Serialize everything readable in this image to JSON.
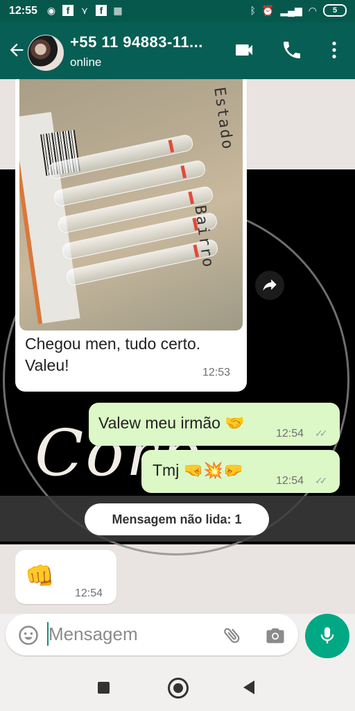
{
  "statusbar": {
    "time": "12:55",
    "battery": "5",
    "left_icons": [
      "whatsapp-icon",
      "facebook-icon",
      "bird-icon",
      "facebook-icon",
      "qr-icon"
    ],
    "right_icons": [
      "bluetooth-icon",
      "alarm-icon",
      "signal-icon",
      "wifi-icon",
      "battery-icon"
    ]
  },
  "header": {
    "contact_name": "+55 11 94883-11...",
    "status": "online"
  },
  "messages": [
    {
      "direction": "in",
      "type": "image",
      "text_line1": "Chegou men, tudo certo.",
      "text_line2": "Valeu!",
      "time": "12:53"
    },
    {
      "direction": "out",
      "text": "Valew meu irmão 🤝",
      "time": "12:54",
      "status": "read"
    },
    {
      "direction": "out",
      "text": "Tmj 🤜💥🤛",
      "time": "12:54",
      "status": "read"
    },
    {
      "direction": "in",
      "text": "👊",
      "time": "12:54"
    }
  ],
  "unread_label": "Mensagem não lida: 1",
  "wallpaper_text": "Corp",
  "photo_handwriting": [
    "Estado",
    "Bairro"
  ],
  "input": {
    "placeholder": "Mensagem"
  },
  "colors": {
    "header": "#075e54",
    "statusbar": "#07584c",
    "outgoing_bubble": "#dcf8c6",
    "accent": "#00a884"
  }
}
